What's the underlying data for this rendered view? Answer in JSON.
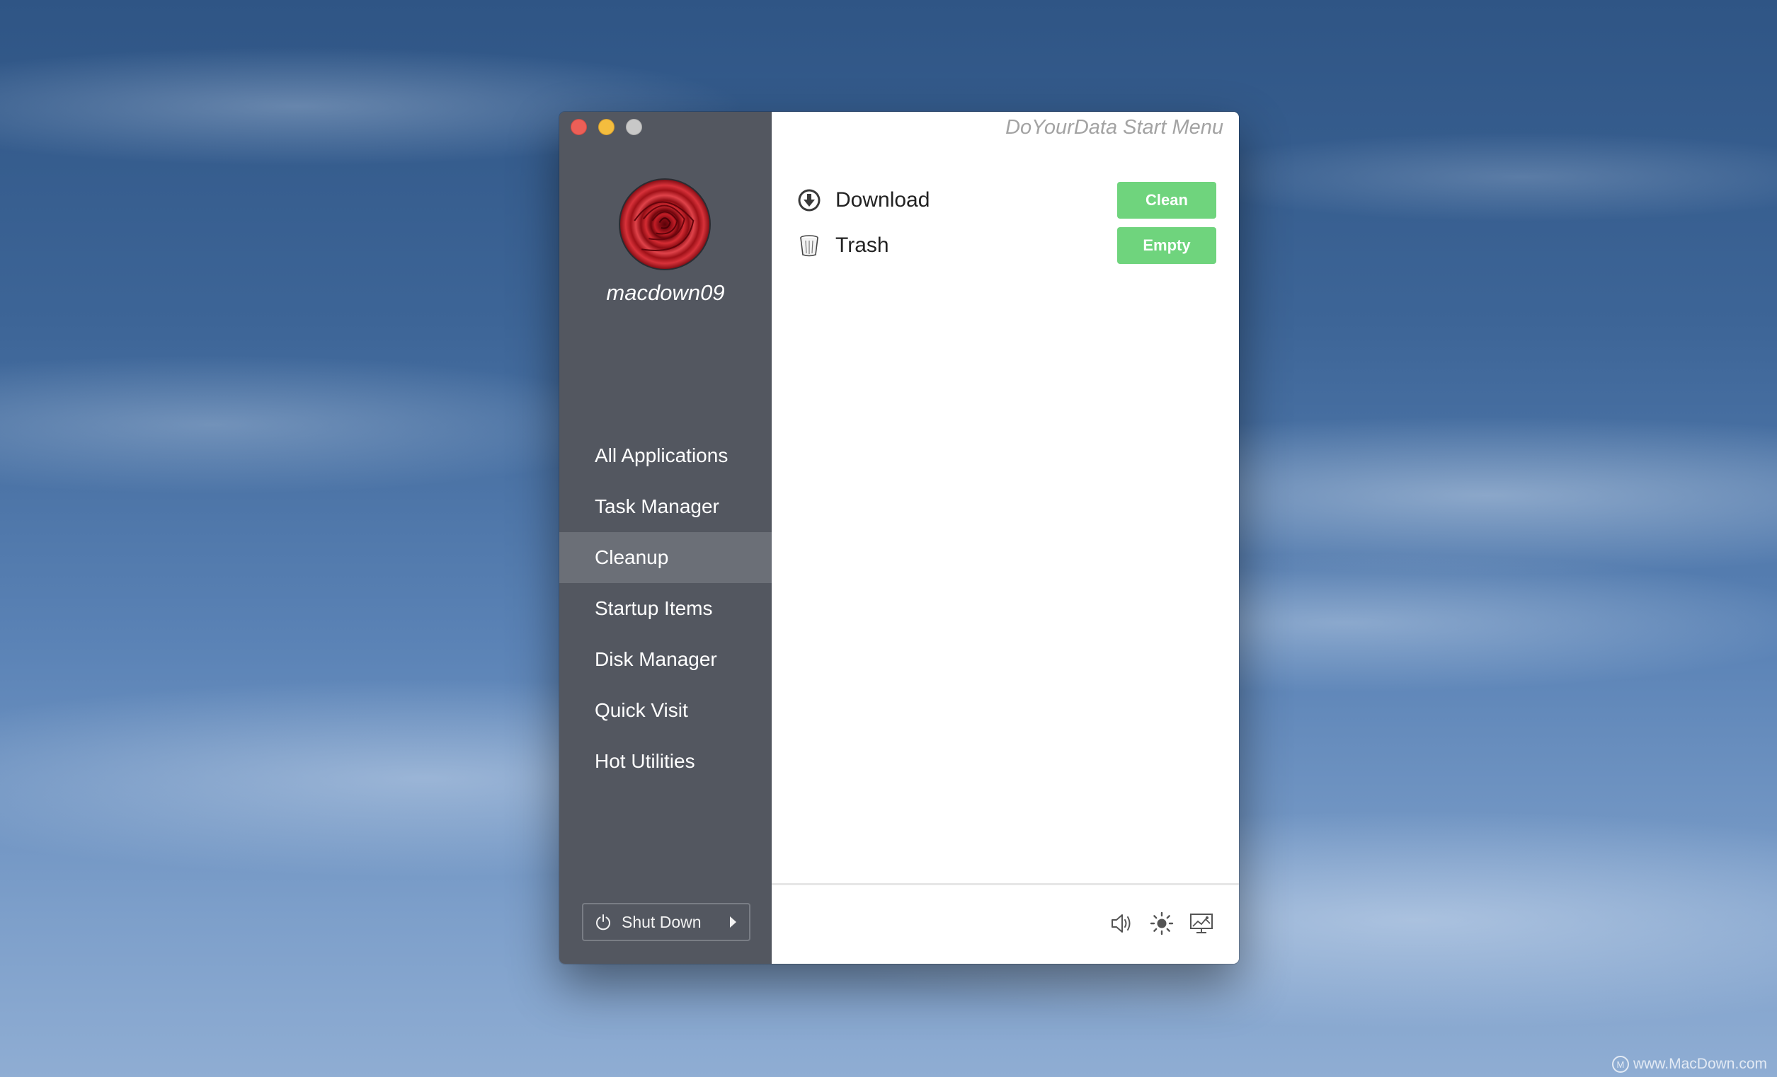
{
  "window": {
    "app_title": "DoYourData Start Menu"
  },
  "sidebar": {
    "username": "macdown09",
    "items": [
      {
        "label": "All Applications",
        "active": false
      },
      {
        "label": "Task Manager",
        "active": false
      },
      {
        "label": "Cleanup",
        "active": true
      },
      {
        "label": "Startup Items",
        "active": false
      },
      {
        "label": "Disk Manager",
        "active": false
      },
      {
        "label": "Quick Visit",
        "active": false
      },
      {
        "label": "Hot Utilities",
        "active": false
      }
    ],
    "shutdown_label": "Shut Down"
  },
  "cleanup": {
    "rows": [
      {
        "icon": "download-icon",
        "label": "Download",
        "button": "Clean"
      },
      {
        "icon": "trash-icon",
        "label": "Trash",
        "button": "Empty"
      }
    ]
  },
  "footer": {
    "icons": [
      "volume-icon",
      "brightness-icon",
      "display-icon"
    ]
  },
  "watermark": {
    "text": "www.MacDown.com",
    "logo": "M"
  },
  "colors": {
    "sidebar_bg": "#535760",
    "sidebar_active": "#6b6f77",
    "button_green": "#6fd47d",
    "close": "#ec5f57",
    "minimize": "#f4bd3e",
    "zoom": "#c8c8c8"
  }
}
